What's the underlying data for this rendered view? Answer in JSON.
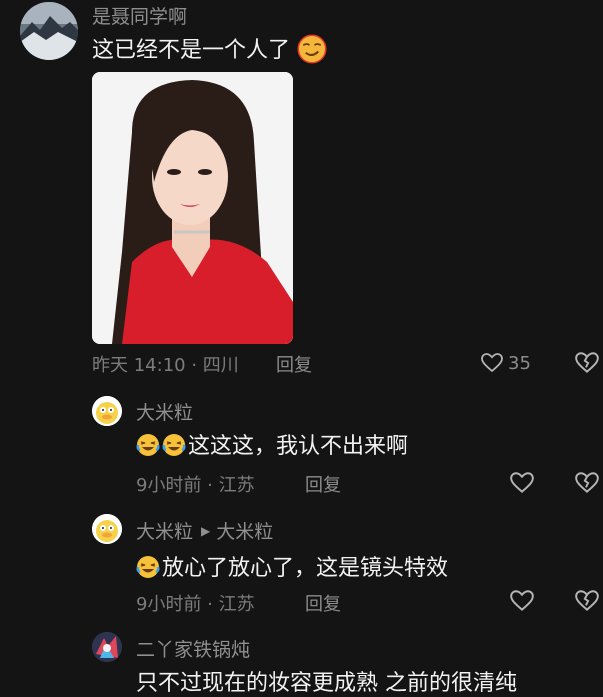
{
  "comment_main": {
    "username": "是聂同学啊",
    "text": "这已经不是一个人了",
    "emoji_icons": [
      "smirk-emoji-icon"
    ],
    "time_location": "昨天 14:10 · 四川",
    "reply_label": "回复",
    "like_count": "35"
  },
  "replies": [
    {
      "username": "大米粒",
      "text": "这这这，我认不出来啊",
      "emoji_icons": [
        "laugh-cry-emoji-icon",
        "laugh-cry-emoji-icon"
      ],
      "time_location": "9小时前 · 江苏",
      "reply_label": "回复"
    },
    {
      "username": "大米粒",
      "reply_to": "大米粒",
      "text": "放心了放心了，这是镜头特效",
      "emoji_icons": [
        "laugh-cry-emoji-icon"
      ],
      "time_location": "9小时前 · 江苏",
      "reply_label": "回复"
    }
  ],
  "comment_next": {
    "username": "二丫家铁锅炖",
    "text": "只不过现在的妆容更成熟 之前的很清纯"
  },
  "colors": {
    "background": "#141414",
    "text_primary": "#f2f2f2",
    "text_secondary": "#8f8f8f",
    "photo_bg": "#f7f7f7",
    "photo_dress": "#d81e2b"
  }
}
